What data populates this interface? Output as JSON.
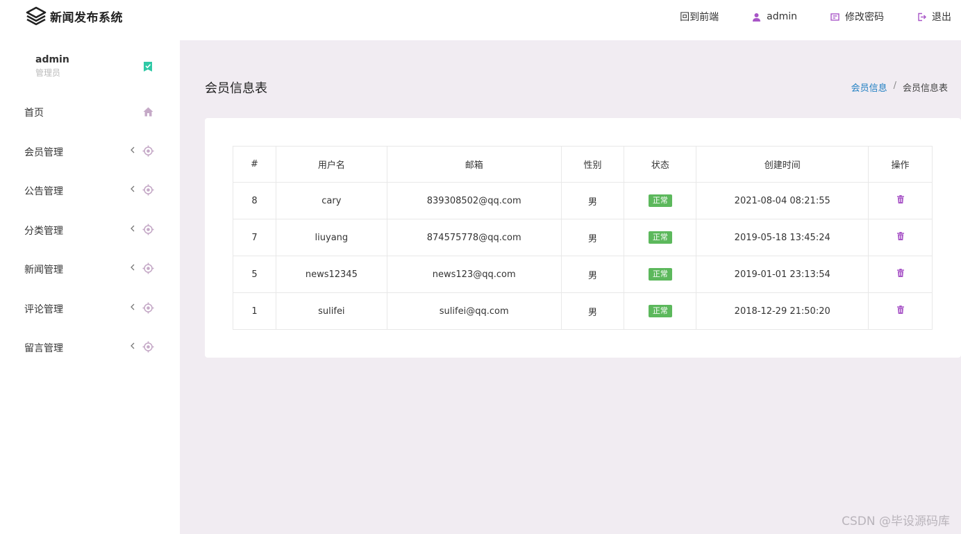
{
  "app": {
    "title": "新闻发布系统"
  },
  "top_nav": {
    "frontend": "回到前端",
    "user": "admin",
    "change_password": "修改密码",
    "logout": "退出"
  },
  "user": {
    "name": "admin",
    "role": "管理员"
  },
  "sidebar": {
    "items": [
      {
        "label": "首页",
        "icon": "home-icon"
      },
      {
        "label": "会员管理",
        "icon": "target-icon"
      },
      {
        "label": "公告管理",
        "icon": "target-icon"
      },
      {
        "label": "分类管理",
        "icon": "target-icon"
      },
      {
        "label": "新闻管理",
        "icon": "target-icon"
      },
      {
        "label": "评论管理",
        "icon": "target-icon"
      },
      {
        "label": "留言管理",
        "icon": "target-icon"
      }
    ]
  },
  "page": {
    "title": "会员信息表"
  },
  "breadcrumb": {
    "parent": "会员信息",
    "separator": "/",
    "current": "会员信息表"
  },
  "table": {
    "headers": [
      "#",
      "用户名",
      "邮箱",
      "性别",
      "状态",
      "创建时间",
      "操作"
    ],
    "rows": [
      {
        "id": "8",
        "username": "cary",
        "email": "839308502@qq.com",
        "gender": "男",
        "status": "正常",
        "created": "2021-08-04 08:21:55"
      },
      {
        "id": "7",
        "username": "liuyang",
        "email": "874575778@qq.com",
        "gender": "男",
        "status": "正常",
        "created": "2019-05-18 13:45:24"
      },
      {
        "id": "5",
        "username": "news12345",
        "email": "news123@qq.com",
        "gender": "男",
        "status": "正常",
        "created": "2019-01-01 23:13:54"
      },
      {
        "id": "1",
        "username": "sulifei",
        "email": "sulifei@qq.com",
        "gender": "男",
        "status": "正常",
        "created": "2018-12-29 21:50:20"
      }
    ]
  },
  "colors": {
    "accent": "#a855c7",
    "status_ok": "#5cb85c",
    "link": "#1e7ec2",
    "main_bg": "#f1ecf2"
  },
  "watermark": "CSDN @毕设源码库"
}
